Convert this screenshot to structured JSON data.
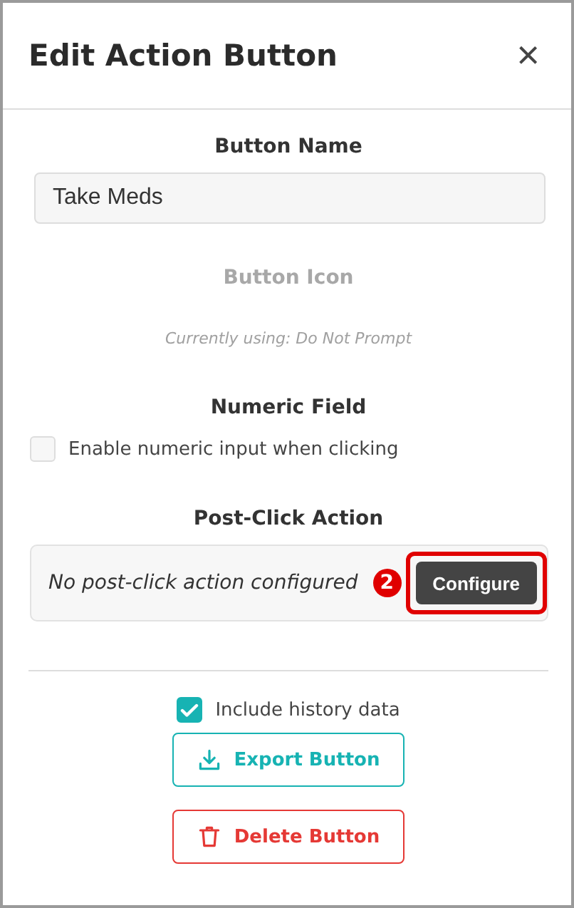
{
  "dialog": {
    "title": "Edit Action Button",
    "close": "×"
  },
  "name_section": {
    "label": "Button Name",
    "value": "Take Meds"
  },
  "icon_section": {
    "label": "Button Icon",
    "status": "Currently using: Do Not Prompt",
    "disabled": true
  },
  "numeric_section": {
    "label": "Numeric Field",
    "checkbox": {
      "label": "Enable numeric input when clicking",
      "checked": false
    }
  },
  "post_click_section": {
    "label": "Post-Click Action",
    "message": "No post-click action configured",
    "button": "Configure",
    "annotation": {
      "number": "2",
      "highlighted": true
    }
  },
  "footer": {
    "checkbox": {
      "label": "Include history data",
      "checked": true
    },
    "buttons": [
      {
        "kind": "export",
        "label": "Export Button"
      },
      {
        "kind": "delete",
        "label": "Delete Button"
      }
    ]
  }
}
